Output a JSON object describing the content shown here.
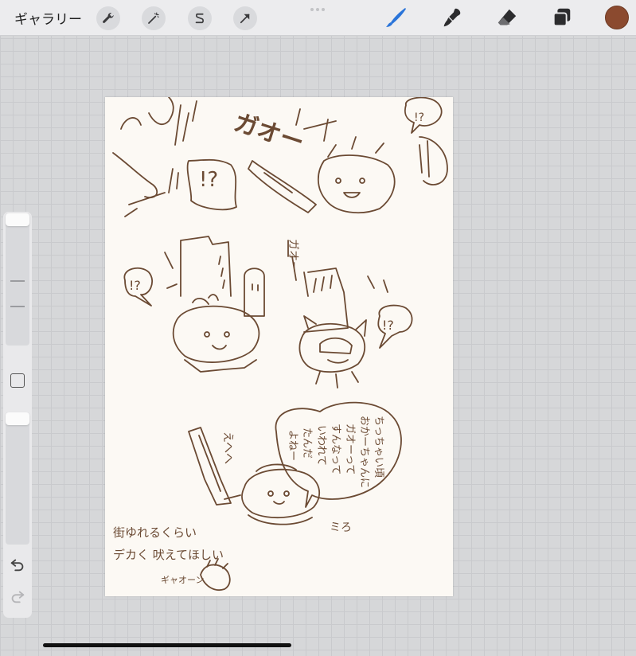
{
  "topbar": {
    "gallery_label": "ギャラリー",
    "left_tools": [
      "wrench-icon",
      "magic-wand-icon",
      "selection-icon",
      "transform-arrow-icon"
    ],
    "right_tools": [
      "brush-icon",
      "smudge-icon",
      "eraser-icon",
      "layers-icon"
    ],
    "active_tool": "brush-icon",
    "color": "#8b4a2f"
  },
  "sidebar": {
    "controls": [
      "brush-size-slider",
      "modify-button",
      "opacity-slider",
      "undo-icon",
      "redo-icon"
    ]
  },
  "canvas": {
    "stroke_color": "#6b4a33",
    "texts": {
      "gao1": "ガオー",
      "q1": "!?",
      "q2": "!?",
      "q3": "!?",
      "q4": "!?",
      "gao2": "ガオー",
      "q5": "!?",
      "ehe": "えへへ",
      "bubble_col1": "ちっちゃい頃",
      "bubble_col2": "おかーちゃんに",
      "bubble_col3": "ガオーって",
      "bubble_col4": "すんなって",
      "bubble_col5": "いわれて",
      "bubble_col6": "たんだ",
      "bubble_col7": "よねー",
      "dodo": "ミろ",
      "line1": "街ゆれるくらい",
      "line2": "デカく 吠えてほしい",
      "small_gao": "ギャオーン"
    }
  }
}
